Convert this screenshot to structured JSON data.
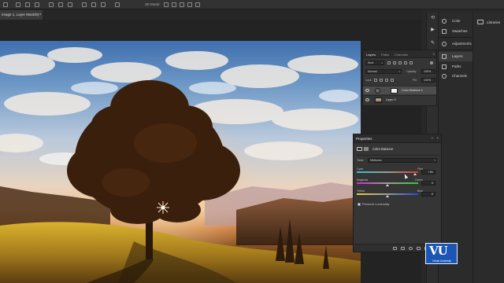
{
  "options_bar": {
    "mode_label": "3D Mode:"
  },
  "document_tab": {
    "title": "Image 1, Layer Mask/8) *",
    "close_glyph": "×"
  },
  "right_icons": [
    "history-icon",
    "play-icon",
    "brush-icon"
  ],
  "panel_names": {
    "color": "Color",
    "swatches": "Swatches",
    "adjustments": "Adjustments",
    "layers": "Layers",
    "paths": "Paths",
    "channels": "Channels",
    "libraries": "Libraries"
  },
  "layers_panel": {
    "tabs": [
      "Layers",
      "Paths",
      "Channels"
    ],
    "kind_filter": "Kind",
    "blend_mode": "Normal",
    "opacity_label": "Opacity:",
    "opacity_value": "100%",
    "lock_label": "Lock:",
    "fill_label": "Fill:",
    "fill_value": "100%",
    "layers": [
      {
        "name": "Color Balance 1",
        "selected": true
      },
      {
        "name": "Layer 0",
        "selected": false
      }
    ]
  },
  "properties_panel": {
    "title": "Properties",
    "adjustment_name": "Color Balance",
    "tone_label": "Tone:",
    "tone_value": "Midtones",
    "sliders": [
      {
        "left": "Cyan",
        "right": "Red",
        "value": "+91",
        "position": 0.955
      },
      {
        "left": "Magenta",
        "right": "Green",
        "value": "0",
        "position": 0.5
      },
      {
        "left": "Yellow",
        "right": "Blue",
        "value": "0",
        "position": 0.5
      }
    ],
    "preserve_luminosity_label": "Preserve Luminosity",
    "preserve_luminosity_checked": true
  },
  "watermark": {
    "mark": "VU",
    "subtitle": "Virtual University"
  },
  "colors": {
    "panel_bg": "#353535",
    "app_bg": "#282828",
    "watermark_blue": "#1b56b5"
  }
}
